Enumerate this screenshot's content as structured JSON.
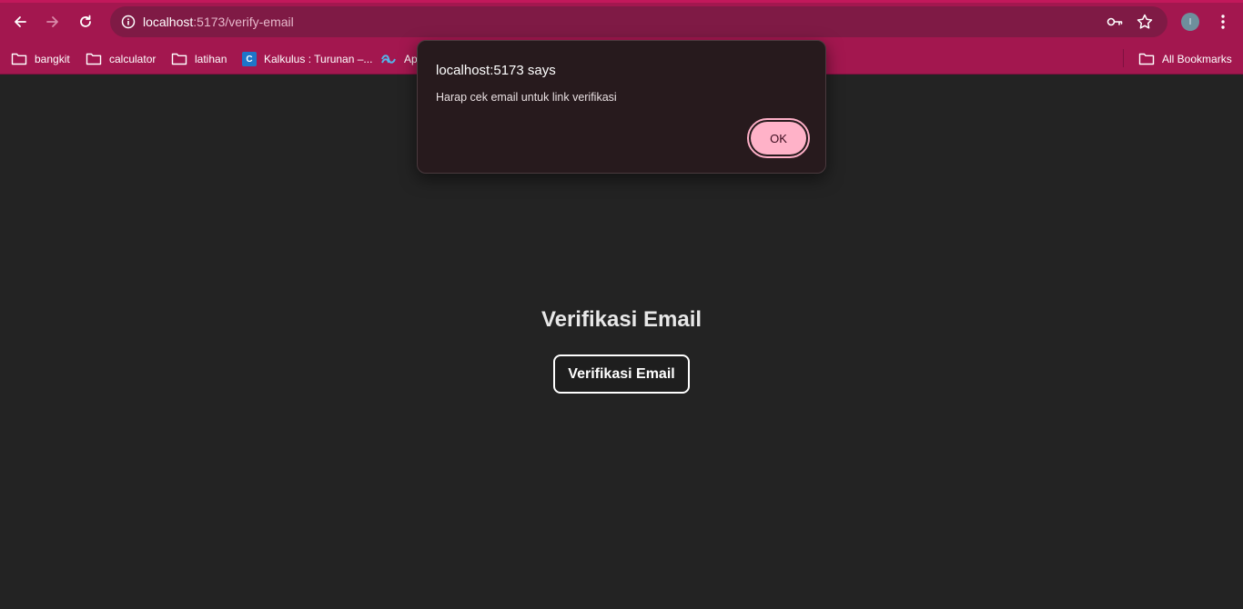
{
  "browser": {
    "url_host": "localhost",
    "url_path": ":5173/verify-email",
    "profile_initial": "I",
    "bookmarks": [
      {
        "label": "bangkit",
        "icon": "folder-icon"
      },
      {
        "label": "calculator",
        "icon": "folder-icon"
      },
      {
        "label": "latihan",
        "icon": "folder-icon"
      },
      {
        "label": "Kalkulus : Turunan –...",
        "icon": "kalkulus-favicon"
      },
      {
        "label": "Apa",
        "icon": "site-favicon"
      }
    ],
    "all_bookmarks_label": "All Bookmarks",
    "theme_color": "#a3174f"
  },
  "dialog": {
    "title": "localhost:5173 says",
    "message": "Harap cek email untuk link verifikasi",
    "ok_label": "OK"
  },
  "page": {
    "title": "Verifikasi Email",
    "button_label": "Verifikasi Email",
    "background": "#232323"
  }
}
